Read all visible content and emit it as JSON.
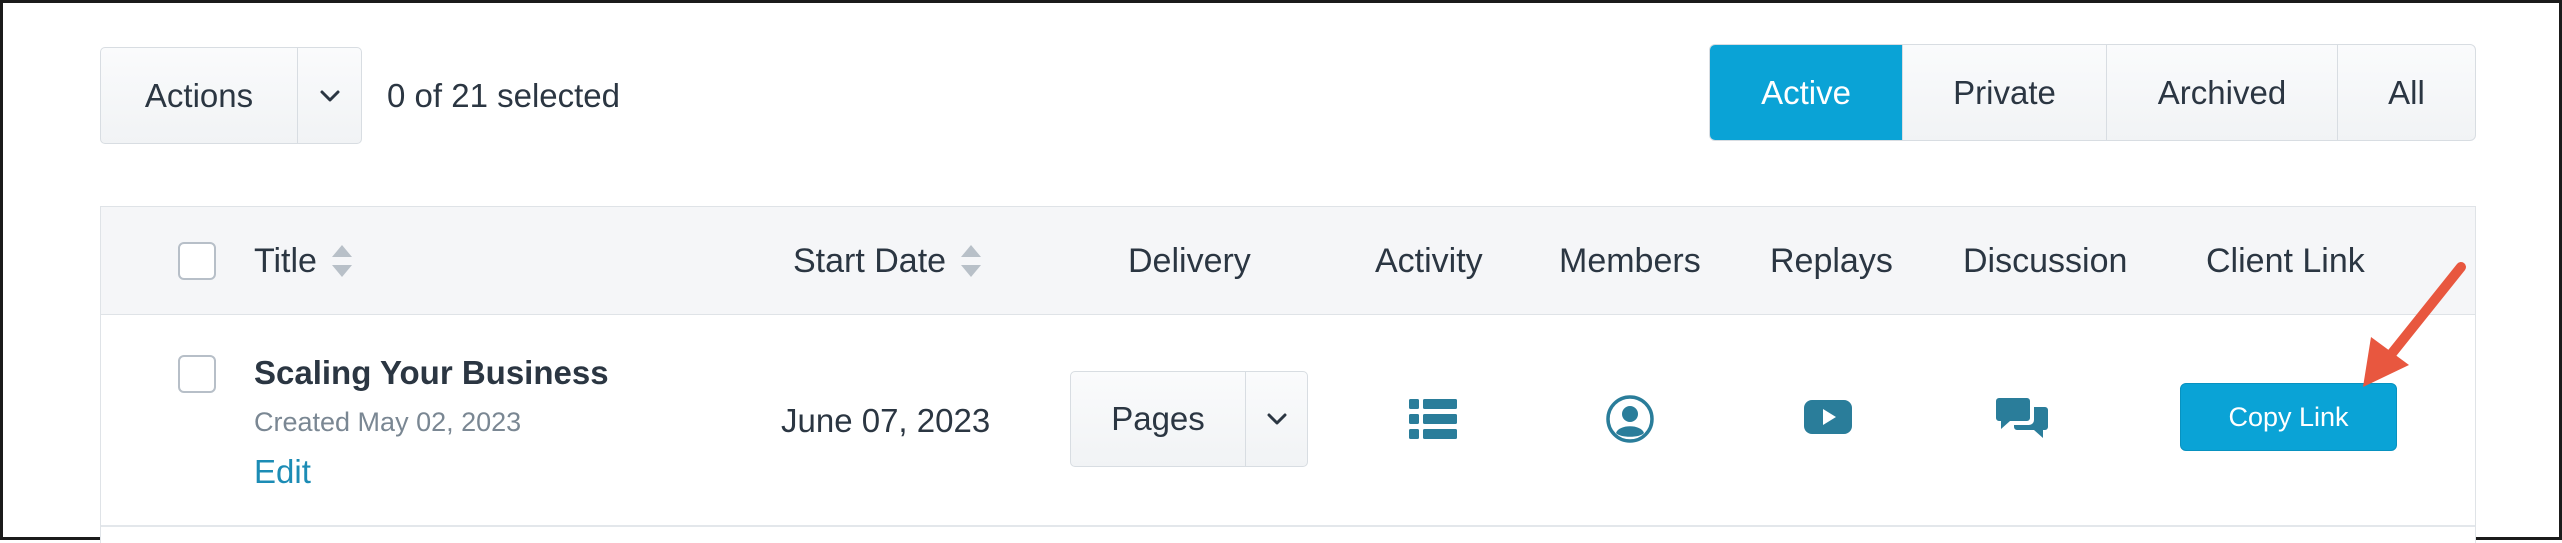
{
  "toolbar": {
    "actions_label": "Actions",
    "selected_count": "0 of 21 selected",
    "filters": [
      "Active",
      "Private",
      "Archived",
      "All"
    ],
    "active_filter": "Active"
  },
  "table": {
    "columns": {
      "title": "Title",
      "start_date": "Start Date",
      "delivery": "Delivery",
      "activity": "Activity",
      "members": "Members",
      "replays": "Replays",
      "discussion": "Discussion",
      "client_link": "Client Link"
    },
    "rows": [
      {
        "title": "Scaling Your Business",
        "created": "Created May 02, 2023",
        "edit_label": "Edit",
        "start_date": "June 07, 2023",
        "delivery": "Pages",
        "activity_icon": "list-icon",
        "members_icon": "user-circle-icon",
        "replays_icon": "play-video-icon",
        "discussion_icon": "chat-bubbles-icon",
        "copy_link_label": "Copy Link"
      }
    ]
  },
  "colors": {
    "accent": "#0aa3d6",
    "icon": "#2a7d9a",
    "annotation_arrow": "#e8573f"
  }
}
